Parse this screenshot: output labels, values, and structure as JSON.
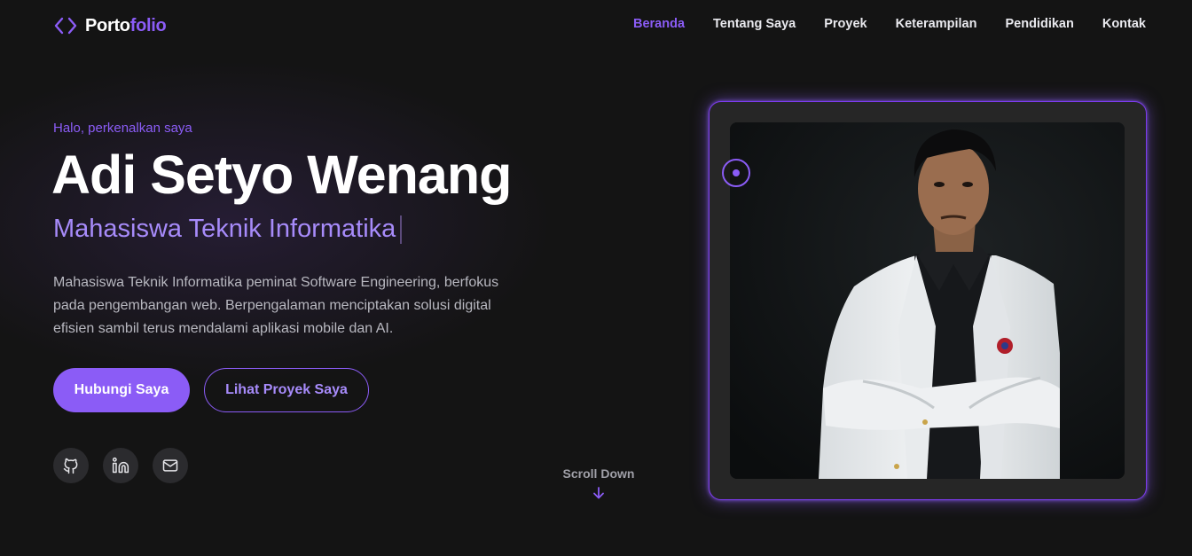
{
  "brand": {
    "part1": "Porto",
    "part2": "folio",
    "accent_color": "#8b5cf6",
    "icon": "code-brackets-icon"
  },
  "nav": {
    "items": [
      {
        "label": "Beranda",
        "active": true
      },
      {
        "label": "Tentang Saya",
        "active": false
      },
      {
        "label": "Proyek",
        "active": false
      },
      {
        "label": "Keterampilan",
        "active": false
      },
      {
        "label": "Pendidikan",
        "active": false
      },
      {
        "label": "Kontak",
        "active": false
      }
    ]
  },
  "hero": {
    "greeting": "Halo, perkenalkan saya",
    "name": "Adi Setyo Wenang",
    "role": "Mahasiswa Teknik Informatika",
    "description": "Mahasiswa Teknik Informatika peminat Software Engineering, berfokus pada pengembangan web. Berpengalaman menciptakan solusi digital efisien sambil terus mendalami aplikasi mobile dan AI.",
    "primary_button": "Hubungi Saya",
    "secondary_button": "Lihat Proyek Saya",
    "socials": [
      "github-icon",
      "linkedin-icon",
      "mail-icon"
    ],
    "scroll_label": "Scroll Down"
  },
  "colors": {
    "background": "#141414",
    "accent": "#8b5cf6",
    "accent_light": "#a78bfa"
  }
}
